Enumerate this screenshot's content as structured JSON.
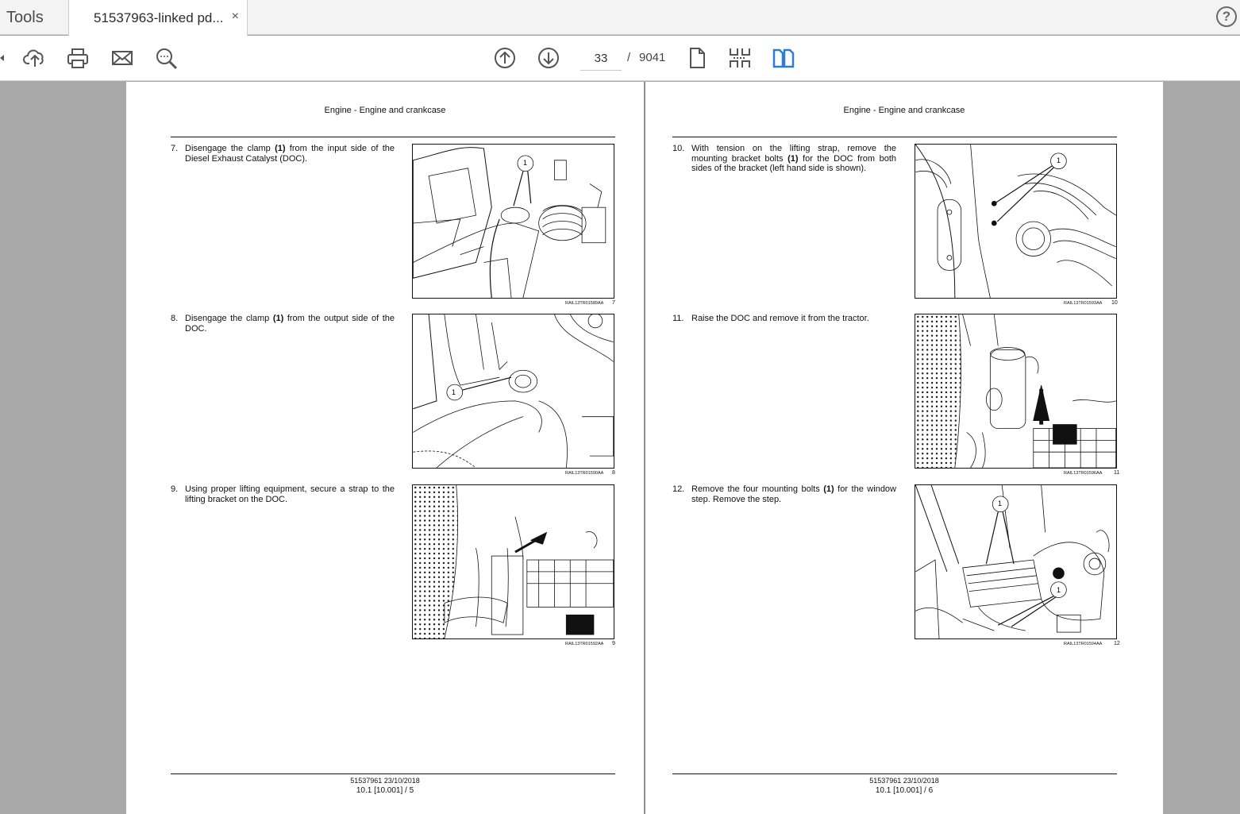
{
  "tabs": {
    "tools_label": "Tools",
    "doc_label": "51537963-linked pd...",
    "close_glyph": "×",
    "help_glyph": "?"
  },
  "toolbar": {
    "current_page": "33",
    "page_separator": "/",
    "total_pages": "9041",
    "icons": [
      "upload-icon",
      "print-icon",
      "email-icon",
      "zoom-search-icon",
      "page-up-icon",
      "page-down-icon",
      "single-page-icon",
      "thumbnails-icon",
      "two-page-view-icon"
    ],
    "accent_color": "#2a7fd4"
  },
  "pages": [
    {
      "header": "Engine - Engine and crankcase",
      "steps": [
        {
          "num": "7.",
          "text_before": "Disengage the clamp ",
          "bold": "(1)",
          "text_after": " from the input side of the Diesel Exhaust Catalyst (DOC).",
          "fig_code": "RAIL13TR01589AA",
          "fig_num": "7"
        },
        {
          "num": "8.",
          "text_before": "Disengage the clamp ",
          "bold": "(1)",
          "text_after": " from the output side of the DOC.",
          "fig_code": "RAIL13TR01590AA",
          "fig_num": "8"
        },
        {
          "num": "9.",
          "text_before": "Using proper lifting equipment, secure a strap to the lifting bracket on the DOC.",
          "bold": "",
          "text_after": "",
          "fig_code": "RAIL13TR01592AA",
          "fig_num": "9"
        }
      ],
      "footer_line1": "51537961 23/10/2018",
      "footer_line2": "10.1 [10.001] / 5"
    },
    {
      "header": "Engine - Engine and crankcase",
      "steps": [
        {
          "num": "10.",
          "text_before": "With tension on the lifting strap, remove the mounting bracket bolts ",
          "bold": "(1)",
          "text_after": " for the DOC from both sides of the bracket (left hand side is shown).",
          "fig_code": "RAIL13TR01593AA",
          "fig_num": "10"
        },
        {
          "num": "11.",
          "text_before": "Raise the DOC and remove it from the tractor.",
          "bold": "",
          "text_after": "",
          "fig_code": "RAIL13TR01596AA",
          "fig_num": "11"
        },
        {
          "num": "12.",
          "text_before": "Remove the four mounting bolts ",
          "bold": "(1)",
          "text_after": " for the window step.  Remove the step.",
          "fig_code": "RAIL13TR01594AA",
          "fig_num": "12"
        }
      ],
      "footer_line1": "51537961 23/10/2018",
      "footer_line2": "10.1 [10.001] / 6"
    }
  ],
  "callout_label": "1"
}
